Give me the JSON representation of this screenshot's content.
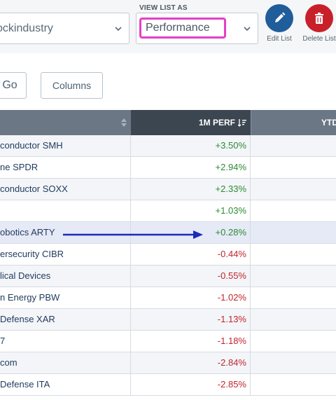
{
  "toolbar": {
    "industry_select_value": "ockindustry",
    "view_list_label": "VIEW LIST AS",
    "view_select_value": "Performance",
    "edit_label": "Edit List",
    "delete_label": "Delete List",
    "edit_icon": "pencil-icon",
    "delete_icon": "trash-icon"
  },
  "buttons": {
    "go_label": "Go",
    "columns_label": "Columns"
  },
  "table": {
    "columns": {
      "perf": "1M PERF",
      "ytd": "YTD"
    },
    "rows": [
      {
        "name": "conductor SMH",
        "perf": "+3.50%",
        "dir": "pos"
      },
      {
        "name": "ne SPDR",
        "perf": "+2.94%",
        "dir": "pos"
      },
      {
        "name": "conductor SOXX",
        "perf": "+2.33%",
        "dir": "pos"
      },
      {
        "name": "",
        "perf": "+1.03%",
        "dir": "pos"
      },
      {
        "name": "obotics ARTY",
        "perf": "+0.28%",
        "dir": "pos"
      },
      {
        "name": "ersecurity CIBR",
        "perf": "-0.44%",
        "dir": "neg"
      },
      {
        "name": "lical Devices",
        "perf": "-0.55%",
        "dir": "neg"
      },
      {
        "name": "n Energy PBW",
        "perf": "-1.02%",
        "dir": "neg"
      },
      {
        "name": "Defense XAR",
        "perf": "-1.13%",
        "dir": "neg"
      },
      {
        "name": "7",
        "perf": "-1.18%",
        "dir": "neg"
      },
      {
        "name": "com",
        "perf": "-2.84%",
        "dir": "neg"
      },
      {
        "name": "Defense ITA",
        "perf": "-2.85%",
        "dir": "neg"
      }
    ]
  },
  "colors": {
    "positive": "#2d8a34",
    "negative": "#c0262e",
    "highlight_border": "#e43fc9",
    "arrow": "#1a2bb8"
  }
}
